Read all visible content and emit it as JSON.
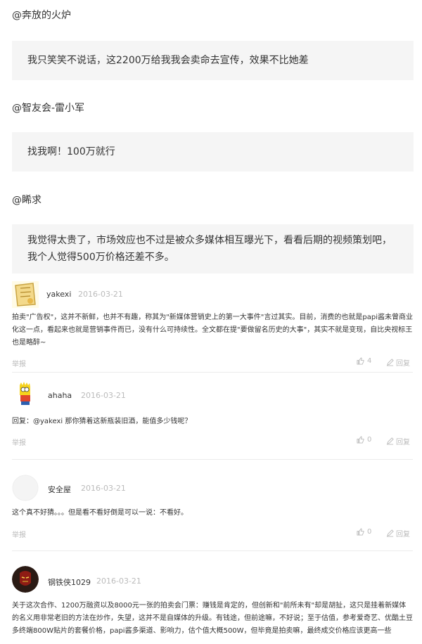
{
  "mentions": [
    {
      "handle": "@奔放的火炉",
      "quote": "我只笑笑不说话，这2200万给我我会卖命去宣传，效果不比她差"
    },
    {
      "handle": "@智友会-雷小军",
      "quote": "找我啊！100万就行"
    },
    {
      "handle": "@睎求",
      "quote": "我觉得太贵了，市场效应也不过是被众多媒体相互曝光下，看看后期的视频策划吧，我个人觉得500万价格还差不多。"
    }
  ],
  "comments": [
    {
      "user": "yakexi",
      "date": "2016-03-21",
      "body": "拍卖\"广告权\"，这并不新鲜，也并不有趣，称其为\"新媒体营销史上的第一大事件\"言过其实。目前，消费的也就是papi酱未曾商业化这一点，看起来也就是营销事件而已，没有什么可持续性。全文都在提\"要做留名历史的大事\"，其实不就是变现，自比央视标王也是略醉~",
      "report": "举报",
      "likes": "4",
      "reply": "回复"
    },
    {
      "user": "ahaha",
      "date": "2016-03-21",
      "body": "回复：@yakexi  那你猜着这新瓶装旧酒，能值多少钱呢？",
      "report": "举报",
      "likes": "0",
      "reply": "回复"
    },
    {
      "user": "安全屋",
      "date": "2016-03-21",
      "body": "这个真不好猜。。。但是看不看好倒是可以一说：不看好。",
      "report": "举报",
      "likes": "0",
      "reply": "回复"
    },
    {
      "user": "钢铁侠1029",
      "date": "2016-03-21",
      "body": "关于这次合作、1200万融资以及8000元一张的拍卖会门票：赚钱是肯定的，但创新和\"前所未有\"却是胡扯，这只是挂着新媒体的名义用非常老旧的方法在炒作，失望，这并不是自媒体的升级。有钱途，但前途嘛，不好说；至于估值，参考爱奇艺、优酷土豆多终端800W贴片的套餐价格，papi酱多渠道、影响力，估个值大概500W，但毕竟是拍卖嘛，最终成交价格应该更高一些"
    }
  ]
}
